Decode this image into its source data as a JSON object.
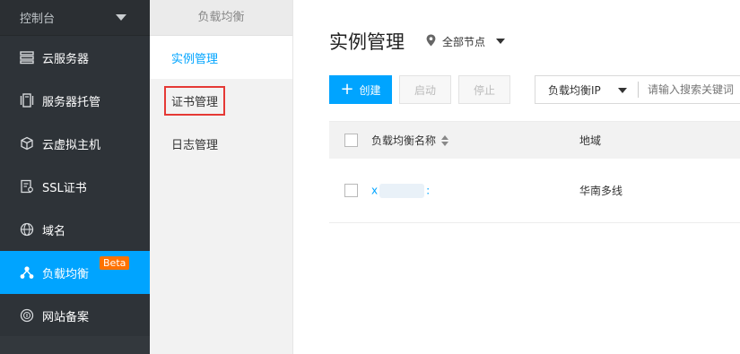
{
  "sidebar": {
    "header": "控制台",
    "items": [
      {
        "label": "云服务器",
        "icon": "server-icon"
      },
      {
        "label": "服务器托管",
        "icon": "hosting-icon"
      },
      {
        "label": "云虚拟主机",
        "icon": "cube-icon"
      },
      {
        "label": "SSL证书",
        "icon": "certificate-icon"
      },
      {
        "label": "域名",
        "icon": "globe-icon"
      },
      {
        "label": "负载均衡",
        "icon": "load-balancer-icon",
        "badge": "Beta",
        "active": true
      },
      {
        "label": "网站备案",
        "icon": "record-icon"
      }
    ]
  },
  "submenu": {
    "header": "负载均衡",
    "items": [
      {
        "label": "实例管理",
        "active": true
      },
      {
        "label": "证书管理",
        "highlighted": true
      },
      {
        "label": "日志管理"
      }
    ]
  },
  "main": {
    "title": "实例管理",
    "region": "全部节点",
    "toolbar": {
      "create": "创建",
      "start": "启动",
      "stop": "停止"
    },
    "search": {
      "field": "负载均衡IP",
      "placeholder": "请输入搜索关键词"
    },
    "table": {
      "headers": [
        "负载均衡名称",
        "地域"
      ],
      "rows": [
        {
          "name_prefix": "x",
          "name_suffix": ":",
          "region": "华南多线"
        }
      ]
    }
  },
  "colors": {
    "accent": "#00a4ff",
    "sidebar_bg": "#2b2f33",
    "beta_badge": "#ff7200",
    "highlight_box": "#e53935"
  }
}
